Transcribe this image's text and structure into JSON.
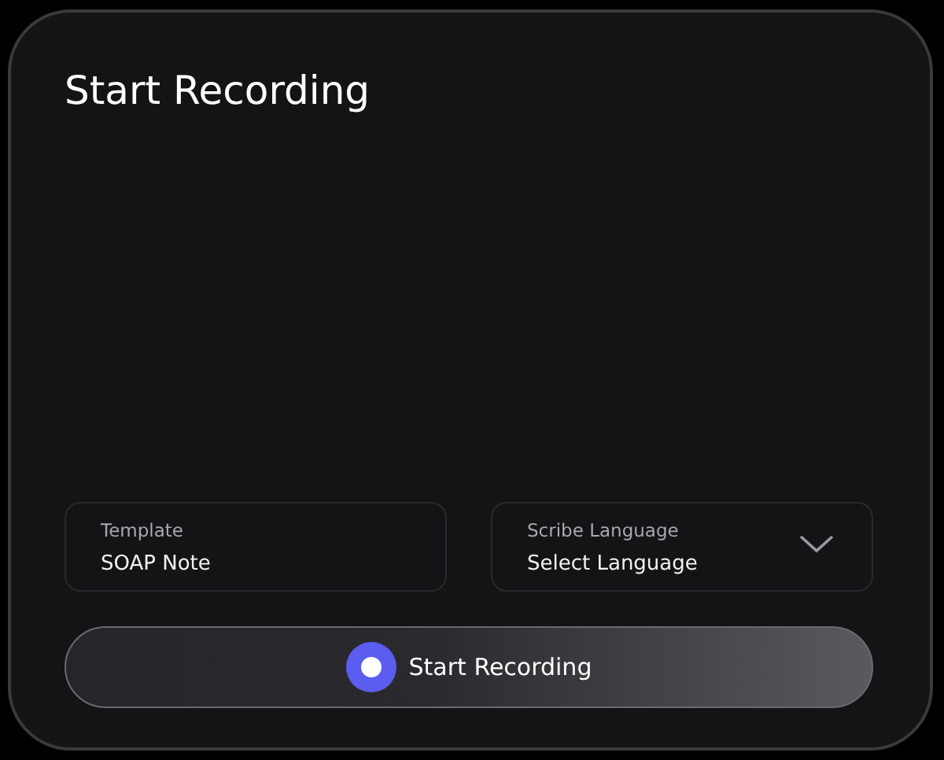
{
  "title": "Start Recording",
  "fields": [
    {
      "kind": "text",
      "label": "Template",
      "value": "SOAP Note"
    },
    {
      "kind": "select",
      "label": "Scribe Language",
      "value": "Select Language"
    }
  ],
  "record_button": {
    "label": "Start Recording"
  }
}
